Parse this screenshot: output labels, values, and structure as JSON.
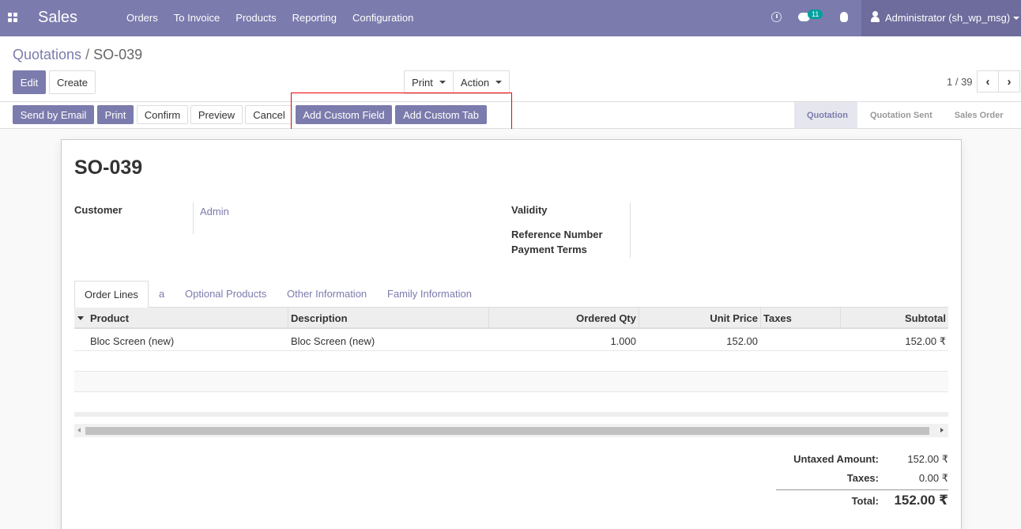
{
  "navbar": {
    "brand": "Sales",
    "menu": [
      "Orders",
      "To Invoice",
      "Products",
      "Reporting",
      "Configuration"
    ],
    "message_count": "11",
    "user": "Administrator (sh_wp_msg)",
    "color": "#7c7bad"
  },
  "breadcrumb": {
    "parent": "Quotations",
    "separator": "/",
    "current": "SO-039"
  },
  "control": {
    "edit": "Edit",
    "create": "Create",
    "print": "Print",
    "action": "Action",
    "pager": "1 / 39"
  },
  "statusbar": {
    "buttons": [
      "Send by Email",
      "Print",
      "Confirm",
      "Preview",
      "Cancel",
      "Add Custom Field",
      "Add Custom Tab"
    ],
    "stages": [
      "Quotation",
      "Quotation Sent",
      "Sales Order"
    ],
    "active_stage": "Quotation"
  },
  "form": {
    "name": "SO-039",
    "customer_label": "Customer",
    "customer_value": "Admin",
    "validity_label": "Validity",
    "reference_label": "Reference Number",
    "payment_terms_label": "Payment Terms"
  },
  "tabs": [
    "Order Lines",
    "a",
    "Optional Products",
    "Other Information",
    "Family Information"
  ],
  "order_lines": {
    "columns": [
      "Product",
      "Description",
      "Ordered Qty",
      "Unit Price",
      "Taxes",
      "Subtotal"
    ],
    "rows": [
      {
        "product": "Bloc Screen (new)",
        "description": "Bloc Screen (new)",
        "qty": "1.000",
        "unit_price": "152.00",
        "taxes": "",
        "subtotal": "152.00 ₹"
      }
    ]
  },
  "totals": {
    "untaxed_label": "Untaxed Amount:",
    "untaxed_value": "152.00 ₹",
    "taxes_label": "Taxes:",
    "taxes_value": "0.00 ₹",
    "total_label": "Total:",
    "total_value": "152.00 ₹"
  }
}
